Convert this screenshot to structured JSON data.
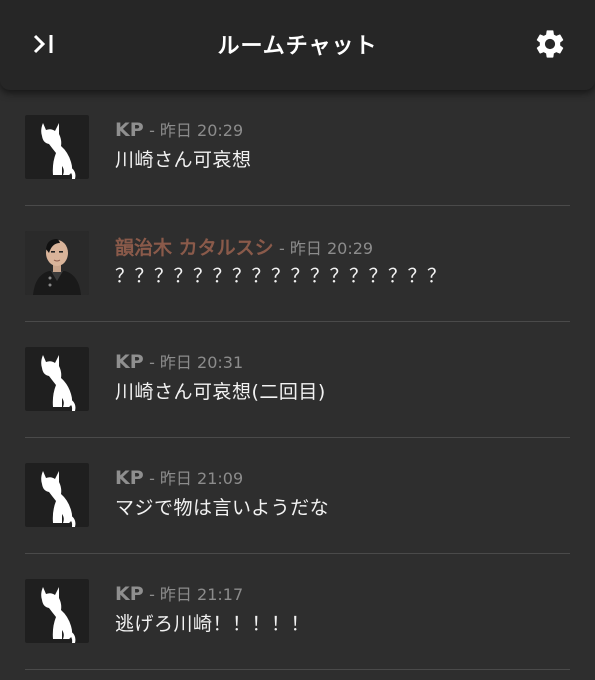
{
  "header": {
    "title": "ルームチャット",
    "collapse_icon": "collapse-panel-icon",
    "settings_icon": "gear-icon"
  },
  "messages": [
    {
      "name": "KP",
      "name_color": "#8f8f8f",
      "time": "- 昨日 20:29",
      "text": "川崎さん可哀想",
      "avatar": "cat-silhouette"
    },
    {
      "name": "韻治木 カタルスシ",
      "name_color": "#8a5a4a",
      "time": "- 昨日 20:29",
      "text": "？？？？？？？？？？？？？？？？？",
      "avatar": "character-portrait"
    },
    {
      "name": "KP",
      "name_color": "#8f8f8f",
      "time": "- 昨日 20:31",
      "text": "川崎さん可哀想(二回目)",
      "avatar": "cat-silhouette"
    },
    {
      "name": "KP",
      "name_color": "#8f8f8f",
      "time": "- 昨日 21:09",
      "text": "マジで物は言いようだな",
      "avatar": "cat-silhouette"
    },
    {
      "name": "KP",
      "name_color": "#8f8f8f",
      "time": "- 昨日 21:17",
      "text": "逃げろ川崎！！！！！",
      "avatar": "cat-silhouette"
    }
  ]
}
